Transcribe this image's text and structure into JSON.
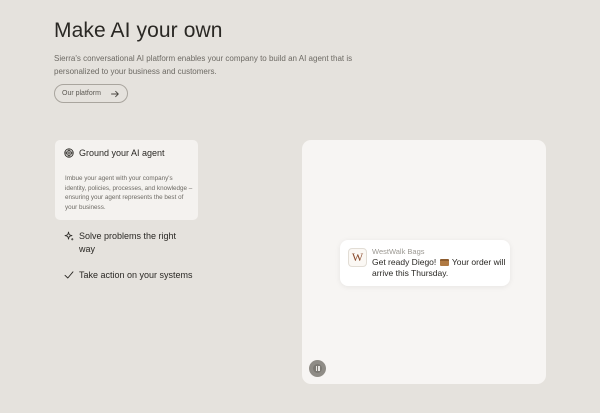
{
  "hero": {
    "headline": "Make AI your own",
    "subtitle": "Sierra's conversational AI platform enables your company to build an AI agent that is personalized to your business and customers.",
    "cta_label": "Our platform",
    "cta_icon": "arrow-right-icon"
  },
  "features": [
    {
      "title": "Ground your AI agent",
      "description": "Imbue your agent with your company's identity, policies, processes, and knowledge – ensuring your agent represents the best of your business.",
      "icon": "target-icon",
      "active": true
    },
    {
      "title": "Solve problems the right way",
      "icon": "sparkle-icon",
      "active": false
    },
    {
      "title": "Take action on your systems",
      "icon": "checkmark-icon",
      "active": false
    }
  ],
  "demo": {
    "brand_initial": "W",
    "brand_name": "WestWalk Bags",
    "message_before": "Get ready Diego!",
    "message_emoji": "package-emoji",
    "message_after": "Your order will arrive this Thursday.",
    "pause_icon": "pause-icon"
  },
  "colors": {
    "background": "#e5e2dd",
    "card": "#f4f2ef",
    "demo_panel": "#f7f5f3",
    "text": "#2a2824",
    "muted_text": "#6d6a64",
    "brand_logo": "#8a4a2c"
  }
}
